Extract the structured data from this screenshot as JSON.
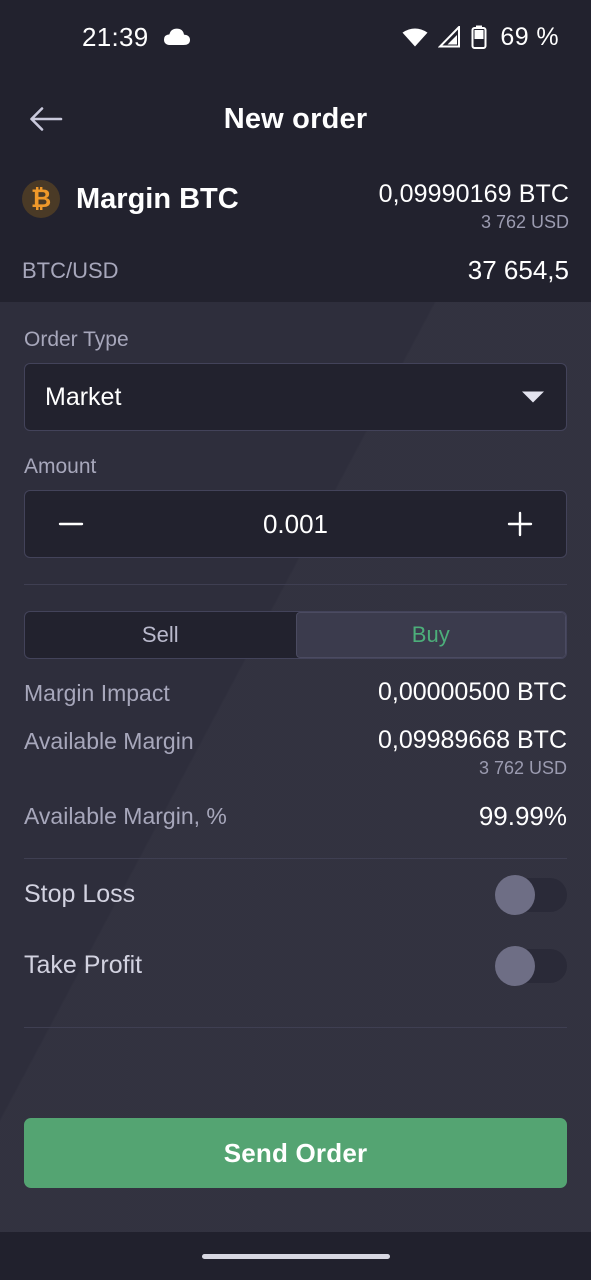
{
  "status_bar": {
    "time": "21:39",
    "weather_icon": "cloud-icon",
    "wifi_icon": "wifi-icon",
    "cellular_icon": "cellular-signal-icon",
    "battery_icon": "battery-icon",
    "battery_text": "69 %"
  },
  "app_bar": {
    "back_icon": "arrow-left-icon",
    "title": "New order"
  },
  "asset": {
    "coin_symbol": "₿",
    "coin_icon": "bitcoin-icon",
    "name": "Margin BTC",
    "balance": "0,09990169 BTC",
    "balance_usd": "3 762 USD",
    "pair_label": "BTC/USD",
    "pair_price": "37 654,5"
  },
  "form": {
    "order_type_label": "Order Type",
    "order_type_value": "Market",
    "order_type_options": [
      "Market"
    ],
    "amount_label": "Amount",
    "amount_value": "0.001",
    "decrement_icon": "minus-icon",
    "increment_icon": "plus-icon"
  },
  "side_toggle": {
    "sell_label": "Sell",
    "buy_label": "Buy",
    "selected": "Buy"
  },
  "info_rows": [
    {
      "label": "Margin Impact",
      "value": "0,00000500 BTC",
      "subvalue": ""
    },
    {
      "label": "Available Margin",
      "value": "0,09989668 BTC",
      "subvalue": "3 762 USD"
    },
    {
      "label": "Available Margin, %",
      "value": "99.99%",
      "subvalue": ""
    }
  ],
  "options": [
    {
      "label": "Stop Loss",
      "enabled": "off"
    },
    {
      "label": "Take Profit",
      "enabled": "off"
    }
  ],
  "cta": {
    "label": "Send Order"
  },
  "colors": {
    "accent_green": "#54a472",
    "buy_text_green": "#4cae7a",
    "bitcoin_orange": "#f0992a",
    "panel_bg": "#2c2c3a",
    "header_bg": "#22222e"
  }
}
